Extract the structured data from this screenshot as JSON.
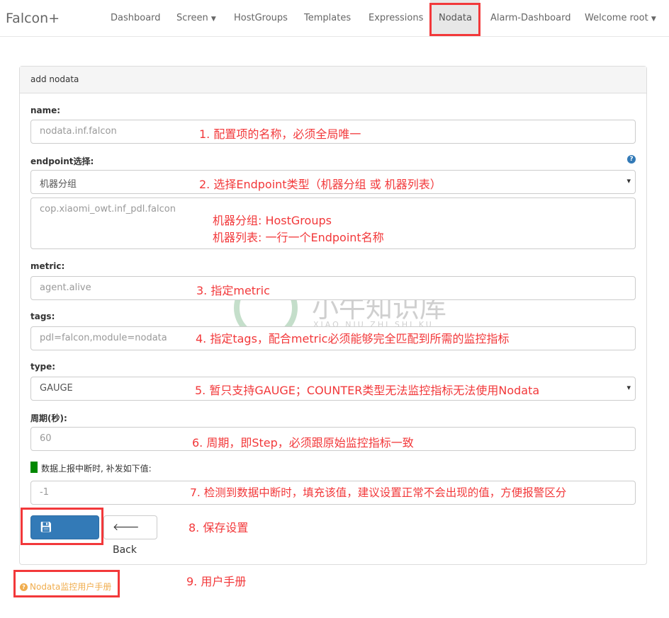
{
  "nav": {
    "brand": "Falcon+",
    "items": [
      {
        "label": "Dashboard"
      },
      {
        "label": "Screen",
        "caret": true
      },
      {
        "label": "HostGroups"
      },
      {
        "label": "Templates"
      },
      {
        "label": "Expressions"
      },
      {
        "label": "Nodata",
        "active": true
      },
      {
        "label": "Alarm-Dashboard"
      },
      {
        "label": "Welcome root",
        "caret": true
      }
    ]
  },
  "panel": {
    "title": "add nodata"
  },
  "form": {
    "name_label": "name:",
    "name_placeholder": "nodata.inf.falcon",
    "endpoint_label": "endpoint选择:",
    "endpoint_value": "机器分组",
    "endpoint_text_placeholder": "cop.xiaomi_owt.inf_pdl.falcon",
    "metric_label": "metric:",
    "metric_placeholder": "agent.alive",
    "tags_label": "tags:",
    "tags_placeholder": "pdl=falcon,module=nodata",
    "type_label": "type:",
    "type_value": "GAUGE",
    "step_label": "周期(秒):",
    "step_placeholder": "60",
    "mock_label": "数据上报中断时, 补发如下值:",
    "mock_placeholder": "-1",
    "submit": "Submit",
    "back": "Back"
  },
  "manual_link": "Nodata监控用户手册",
  "annotations": [
    "1. 配置项的名称，必须全局唯一",
    "2. 选择Endpoint类型（机器分组 或 机器列表）",
    "机器分组: HostGroups",
    "机器列表: 一行一个Endpoint名称",
    "3. 指定metric",
    "4. 指定tags，配合metric必须能够完全匹配到所需的监控指标",
    "5. 暂只支持GAUGE；COUNTER类型无法监控指标无法使用Nodata",
    "6. 周期，即Step，必须跟原始监控指标一致",
    "7. 检测到数据中断时，填充该值，建议设置正常不会出现的值，方便报警区分",
    "8. 保存设置",
    "9. 用户手册"
  ],
  "watermark": {
    "title": "小牛知识库",
    "subtitle": "XIAO NIU ZHI SHI KU"
  },
  "colors": {
    "primary": "#337ab7",
    "annotation": "#f2383a",
    "link": "#f0ad4e",
    "indicator": "#008000"
  }
}
